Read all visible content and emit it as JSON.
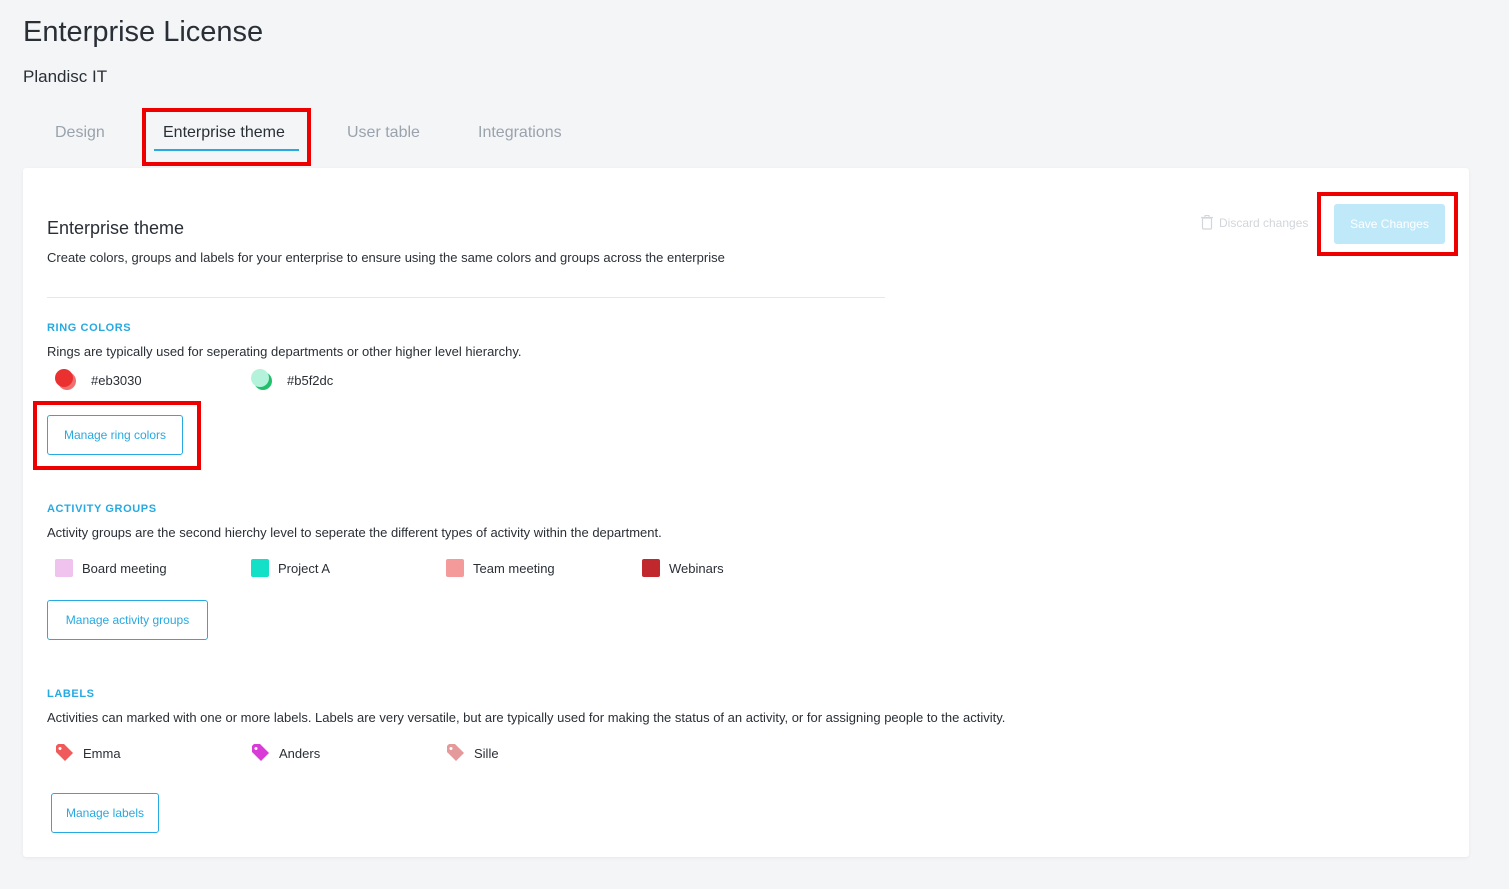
{
  "header": {
    "title": "Enterprise License",
    "subtitle": "Plandisc IT"
  },
  "tabs": [
    {
      "label": "Design"
    },
    {
      "label": "Enterprise theme",
      "active": true
    },
    {
      "label": "User table"
    },
    {
      "label": "Integrations"
    }
  ],
  "card": {
    "title": "Enterprise theme",
    "description": "Create colors, groups and labels for your enterprise to ensure using the same colors and groups across the enterprise",
    "discard_label": "Discard changes",
    "save_label": "Save Changes"
  },
  "ring_colors": {
    "title": "RING COLORS",
    "description": "Rings are typically used for seperating departments or other higher level hierarchy.",
    "items": [
      {
        "label": "#eb3030",
        "color": "#eb3030",
        "shadow": "#f07070"
      },
      {
        "label": "#b5f2dc",
        "color": "#b5f2dc",
        "shadow": "#22c06a"
      }
    ],
    "button_label": "Manage ring colors"
  },
  "activity_groups": {
    "title": "ACTIVITY GROUPS",
    "description": "Activity groups are the second hierchy level to seperate the different types of activity within the department.",
    "items": [
      {
        "label": "Board meeting",
        "color": "#f0c2ee"
      },
      {
        "label": "Project A",
        "color": "#14e0c8"
      },
      {
        "label": "Team meeting",
        "color": "#f59a9a"
      },
      {
        "label": "Webinars",
        "color": "#c0282e"
      }
    ],
    "button_label": "Manage activity groups"
  },
  "labels": {
    "title": "LABELS",
    "description": "Activities can marked with one or more labels. Labels are very versatile, but are typically used for making the status of an activity, or for assigning people to the activity.",
    "items": [
      {
        "label": "Emma",
        "color": "#f05a5a",
        "icon": "tag-icon"
      },
      {
        "label": "Anders",
        "color": "#d93bd6",
        "icon": "tag-icon"
      },
      {
        "label": "Sille",
        "color": "#e49a9a",
        "icon": "tag-icon"
      }
    ],
    "button_label": "Manage labels"
  },
  "colors": {
    "accent": "#27a9e1",
    "highlight": "#ee0000",
    "save_disabled": "#bfe9f9"
  }
}
